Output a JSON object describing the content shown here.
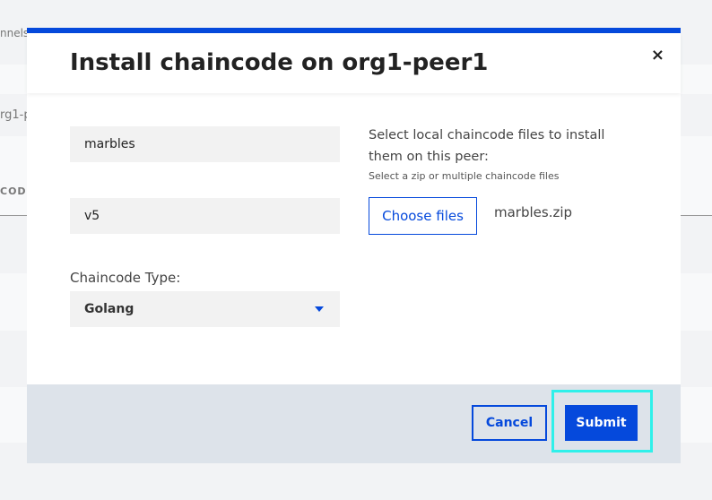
{
  "background": {
    "crumb": "nnels",
    "peer": "rg1-p",
    "column": "CODE"
  },
  "modal": {
    "title": "Install chaincode on org1-peer1",
    "close_label": "×",
    "name_value": "marbles",
    "version_value": "v5",
    "type_label": "Chaincode Type:",
    "type_value": "Golang",
    "files_heading": "Select local chaincode files to install them on this peer:",
    "files_hint": "Select a zip or multiple chaincode files",
    "choose_label": "Choose files",
    "file_name": "marbles.zip",
    "cancel_label": "Cancel",
    "submit_label": "Submit"
  },
  "colors": {
    "accent": "#0549dc",
    "highlight": "#2ff0ea"
  }
}
